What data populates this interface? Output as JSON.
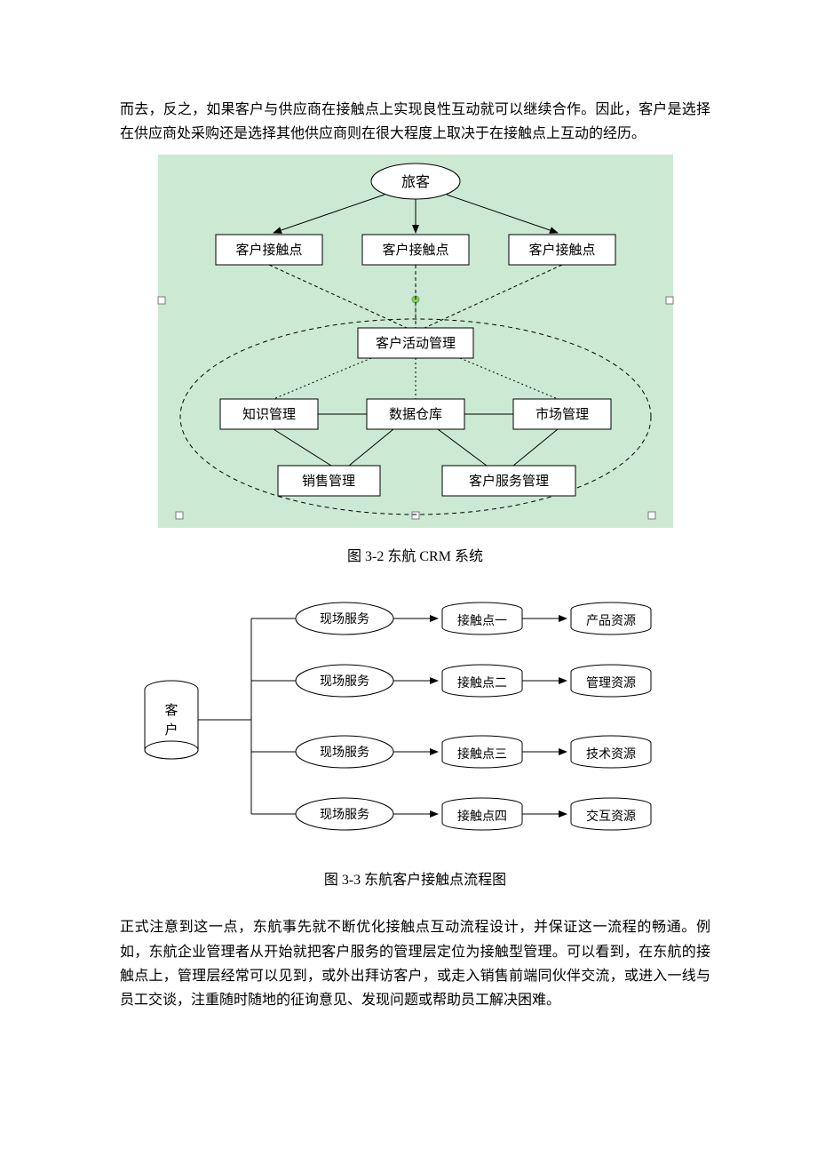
{
  "paragraphs": {
    "p1": "而去，反之，如果客户与供应商在接触点上实现良性互动就可以继续合作。因此，客户是选择在供应商处采购还是选择其他供应商则在很大程度上取决于在接触点上互动的经历。",
    "p2": "正式注意到这一点，东航事先就不断优化接触点互动流程设计，并保证这一流程的畅通。例如，东航企业管理者从开始就把客户服务的管理层定位为接触型管理。可以看到，在东航的接触点上，管理层经常可以见到，或外出拜访客户，或走入销售前端同伙伴交流，或进入一线与员工交谈，注重随时随地的征询意见、发现问题或帮助员工解决困难。"
  },
  "captions": {
    "fig32": "图 3-2 东航 CRM 系统",
    "fig33": "图 3-3 东航客户接触点流程图"
  },
  "fig32": {
    "top": "旅客",
    "row1": [
      "客户接触点",
      "客户接触点",
      "客户接触点"
    ],
    "mid": "客户活动管理",
    "row2": [
      "知识管理",
      "数据仓库",
      "市场管理"
    ],
    "row3": [
      "销售管理",
      "客户服务管理"
    ]
  },
  "fig33": {
    "customer": "客\n户",
    "rows": [
      {
        "service": "现场服务",
        "touch": "接触点一",
        "res": "产品资源"
      },
      {
        "service": "现场服务",
        "touch": "接触点二",
        "res": "管理资源"
      },
      {
        "service": "现场服务",
        "touch": "接触点三",
        "res": "技术资源"
      },
      {
        "service": "现场服务",
        "touch": "接触点四",
        "res": "交互资源"
      }
    ]
  },
  "colors": {
    "figbg": "#cce9d3",
    "border": "#000"
  }
}
